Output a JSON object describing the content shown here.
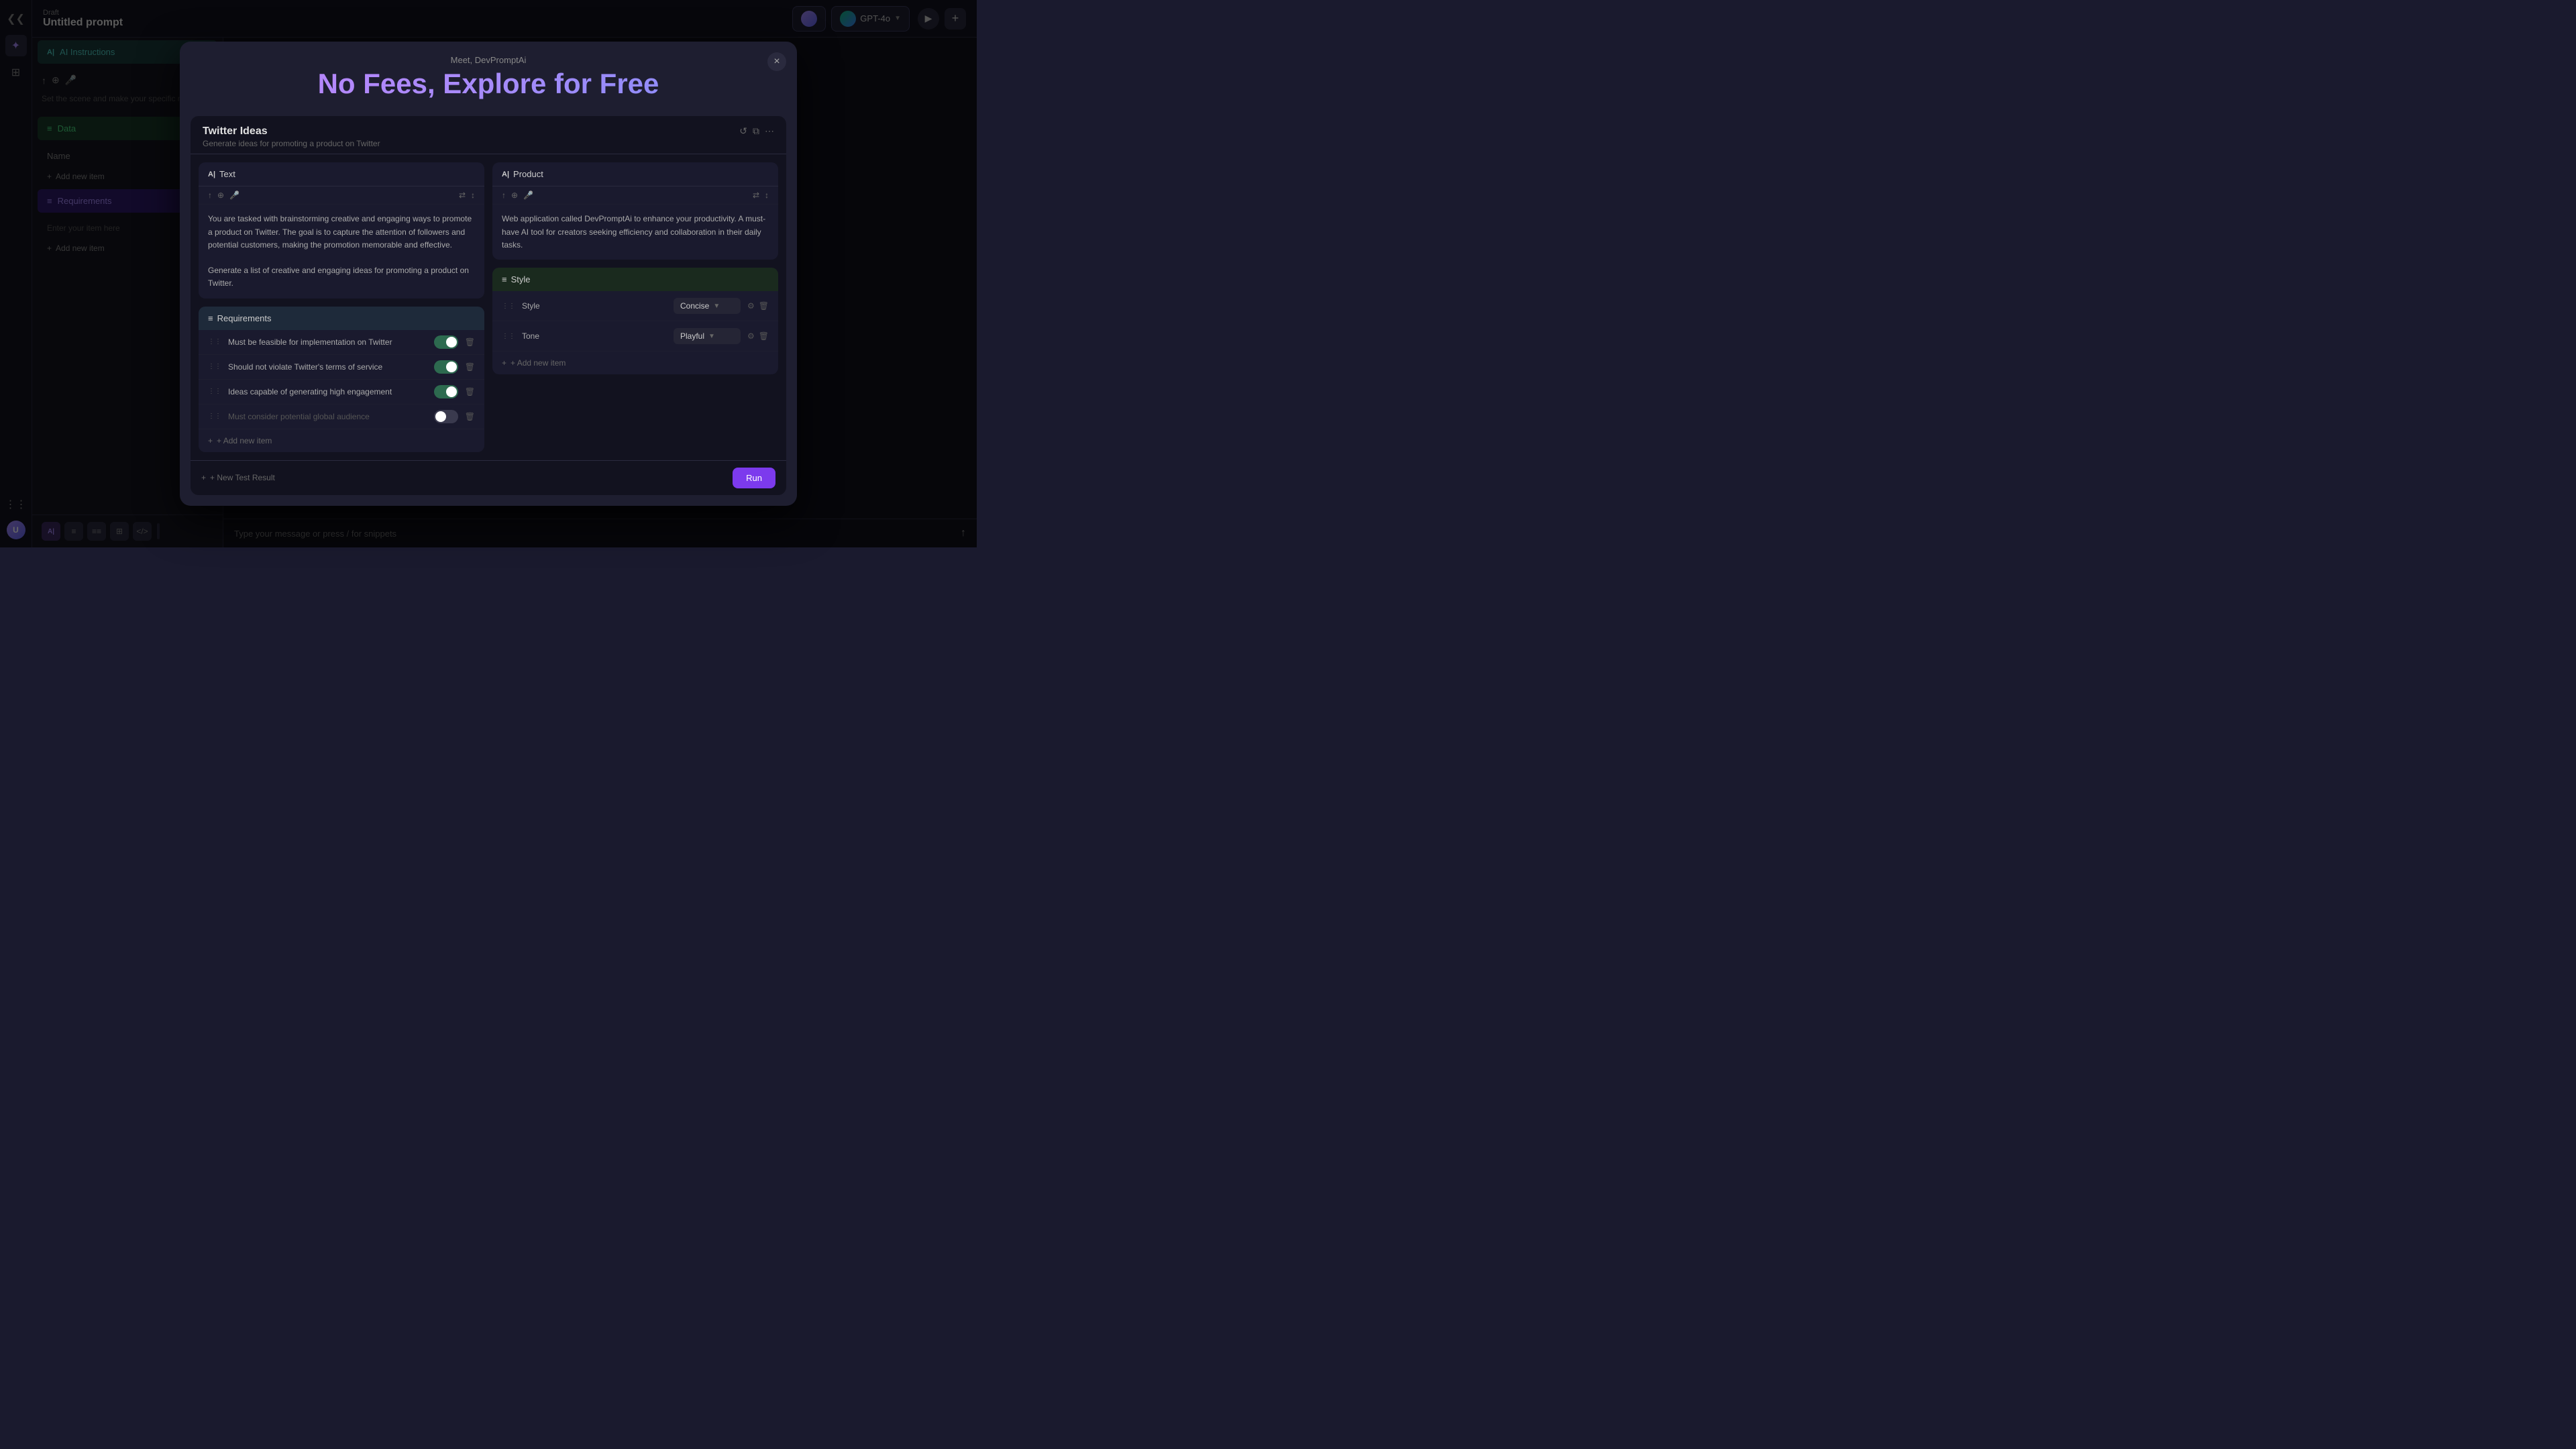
{
  "app": {
    "draft_label": "Draft",
    "prompt_title": "Untitled prompt"
  },
  "sidebar": {
    "icons": [
      "chevrons-left",
      "sparkles",
      "grid",
      "more-horizontal"
    ]
  },
  "top_bar": {
    "model_name": "GPT-4o",
    "run_icon": "▶",
    "add_icon": "+"
  },
  "left_panel": {
    "instructions_label": "AI Instructions",
    "instructions_icon": "A|",
    "data_label": "Data",
    "data_icon": "≡",
    "requirements_label": "Requirements",
    "requirements_icon": "≡",
    "data_name_placeholder": "Name",
    "add_item_label": "+ Add new item",
    "requirements_placeholder": "Enter your item here",
    "instructions_placeholder": "Set the scene and make your specific m..."
  },
  "bottom_toolbar": {
    "tools": [
      "A|",
      "≡",
      "≡≡",
      "⊞",
      "</>"
    ]
  },
  "chat": {
    "input_placeholder": "Type your message or press / for snippets"
  },
  "modal": {
    "close_label": "×",
    "meet_label": "Meet, DevPromptAi",
    "hero_title": "No Fees, Explore for Free",
    "demo": {
      "title": "Twitter Ideas",
      "subtitle": "Generate ideas for promoting a product on Twitter",
      "text_section": {
        "label": "Text",
        "icon": "A|",
        "content": "You are tasked with brainstorming creative and engaging ways to promote a product on Twitter. The goal is to capture the attention of followers and potential customers, making the promotion memorable and effective.\n\nGenerate a list of creative and engaging ideas for promoting a product on Twitter."
      },
      "product_section": {
        "label": "Product",
        "icon": "A|",
        "content": "Web application called DevPromptAi to enhance your productivity.  A must-have AI tool for creators seeking efficiency and collaboration in their daily tasks."
      },
      "requirements_section": {
        "label": "Requirements",
        "icon": "≡",
        "items": [
          {
            "label": "Must be feasible for implementation on Twitter",
            "enabled": true
          },
          {
            "label": "Should not violate Twitter's terms of service",
            "enabled": true
          },
          {
            "label": "Ideas capable of generating high engagement",
            "enabled": true
          },
          {
            "label": "Must consider potential global audience",
            "enabled": false
          }
        ],
        "add_label": "+ Add new item"
      },
      "style_section": {
        "label": "Style",
        "icon": "≡",
        "rows": [
          {
            "label": "Style",
            "value": "Concise"
          },
          {
            "label": "Tone",
            "value": "Playful"
          }
        ],
        "add_label": "+ Add new item"
      },
      "bottom_bar": {
        "new_test_label": "+ New Test Result",
        "run_label": "Run"
      }
    }
  }
}
